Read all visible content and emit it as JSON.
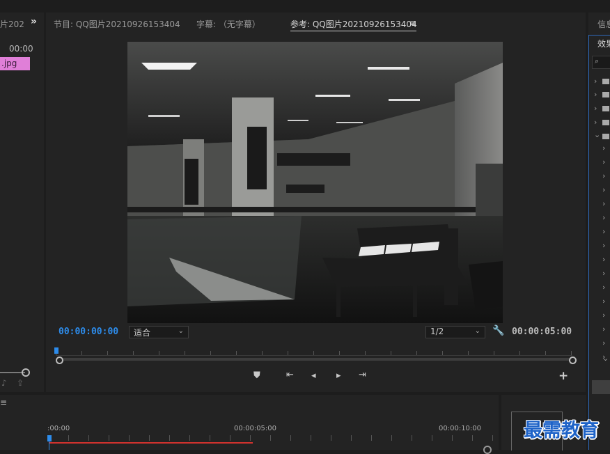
{
  "project_panel": {
    "tab_fragment": "片202",
    "timecode": "00:00",
    "clip_name": ".jpg"
  },
  "monitor_tabs": {
    "sequence": "节目: QQ图片20210926153404",
    "captions": "字幕: （无字幕）",
    "reference": "参考: QQ图片20210926153404",
    "menu_icon": "hamburger-menu-icon"
  },
  "monitor": {
    "playhead_timecode": "00:00:00:00",
    "fit_label": "适合",
    "resolution_label": "1/2",
    "duration_timecode": "00:00:05:00",
    "controls": [
      "marker-icon",
      "go-to-in-icon",
      "step-back-icon",
      "step-forward-icon",
      "go-to-out-icon"
    ],
    "add_label": "+"
  },
  "timeline": {
    "ruler_labels": [
      ":00:00",
      "00:00:05:00",
      "00:00:10:00"
    ]
  },
  "right_panel": {
    "tab_info": "信息",
    "tab_effects": "效果",
    "search_icon": "search-icon"
  },
  "watermark": "最需教育",
  "colors": {
    "timecode_blue": "#2d8ceb",
    "clip_pink": "#e07fd8",
    "playhead_red": "#d3322e",
    "panel_border_blue": "#2f6bbd"
  }
}
